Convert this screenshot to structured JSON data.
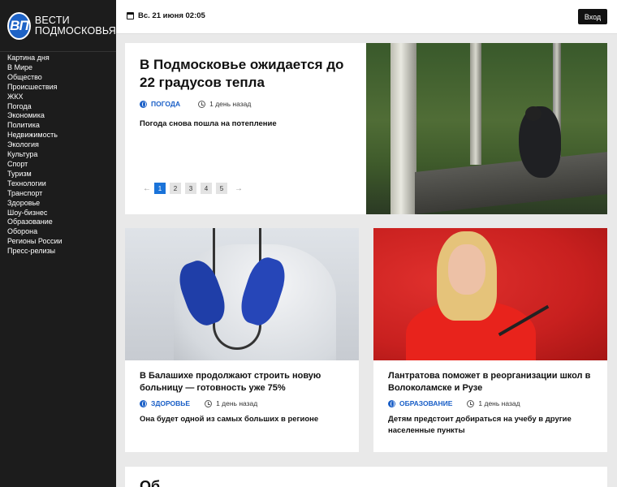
{
  "sidebar": {
    "logo_mark": "ВП",
    "logo_line1": "ВЕСТИ",
    "logo_line2": "ПОДМОСКОВЬЯ",
    "items": [
      "Картина дня",
      "В Мире",
      "Общество",
      "Происшествия",
      "ЖКХ",
      "Погода",
      "Экономика",
      "Политика",
      "Недвижимость",
      "Экология",
      "Культура",
      "Спорт",
      "Туризм",
      "Технологии",
      "Транспорт",
      "Здоровье",
      "Шоу-бизнес",
      "Образование",
      "Оборона",
      "Регионы России",
      "Пресс-релизы"
    ]
  },
  "topbar": {
    "date": "Вс. 21 июня 02:05",
    "login_label": "Вход"
  },
  "hero": {
    "title": "В Подмосковье ожидается до 22 градусов тепла",
    "tag": "ПОГОДА",
    "time": "1 день назад",
    "subtitle": "Погода снова пошла на потепление",
    "pages": [
      "1",
      "2",
      "3",
      "4",
      "5"
    ],
    "active_page": "1",
    "prev_arrow": "←",
    "next_arrow": "→"
  },
  "cards": [
    {
      "title": "В Балашихе продолжают строить новую больницу — готовность уже 75%",
      "tag": "ЗДОРОВЬЕ",
      "time": "1 день назад",
      "subtitle": "Она будет одной из самых больших в регионе"
    },
    {
      "title": "Лантратова поможет в реорганизации школ в Волоколамске и Рузе",
      "tag": "ОБРАЗОВАНИЕ",
      "time": "1 день назад",
      "subtitle": "Детям предстоит добираться на учебу в другие населенные пункты"
    }
  ],
  "bottom": {
    "title": "Об"
  },
  "colors": {
    "accent": "#1a73d9",
    "tag": "#1a5fc7",
    "sidebar": "#1c1c1c"
  }
}
